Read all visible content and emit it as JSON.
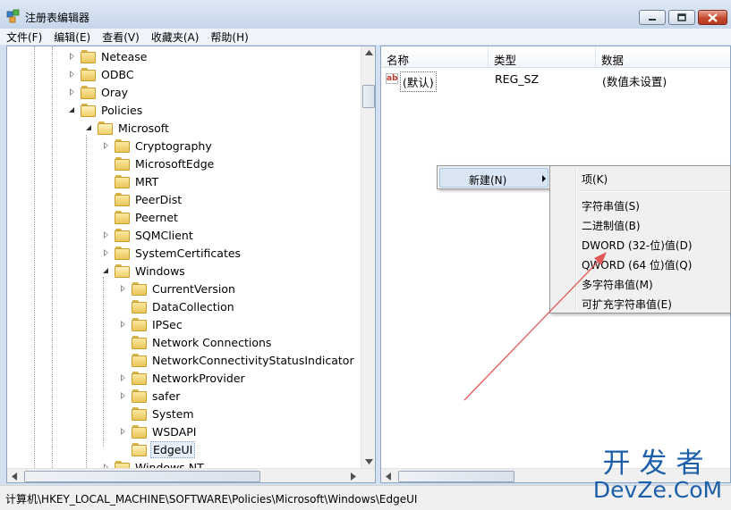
{
  "window": {
    "title": "注册表编辑器",
    "icon": "regedit-icon"
  },
  "menubar": {
    "items": [
      "文件(F)",
      "编辑(E)",
      "查看(V)",
      "收藏夹(A)",
      "帮助(H)"
    ]
  },
  "tree": {
    "nodes": [
      {
        "label": "Netease",
        "state": "collapsed",
        "depth": 3
      },
      {
        "label": "ODBC",
        "state": "collapsed",
        "depth": 3
      },
      {
        "label": "Oray",
        "state": "collapsed",
        "depth": 3
      },
      {
        "label": "Policies",
        "state": "expanded",
        "depth": 3
      },
      {
        "label": "Microsoft",
        "state": "expanded",
        "depth": 4
      },
      {
        "label": "Cryptography",
        "state": "collapsed",
        "depth": 5
      },
      {
        "label": "MicrosoftEdge",
        "state": "leaf",
        "depth": 5
      },
      {
        "label": "MRT",
        "state": "leaf",
        "depth": 5
      },
      {
        "label": "PeerDist",
        "state": "leaf",
        "depth": 5
      },
      {
        "label": "Peernet",
        "state": "leaf",
        "depth": 5
      },
      {
        "label": "SQMClient",
        "state": "collapsed",
        "depth": 5
      },
      {
        "label": "SystemCertificates",
        "state": "collapsed",
        "depth": 5
      },
      {
        "label": "Windows",
        "state": "expanded",
        "depth": 5
      },
      {
        "label": "CurrentVersion",
        "state": "collapsed",
        "depth": 6
      },
      {
        "label": "DataCollection",
        "state": "leaf",
        "depth": 6
      },
      {
        "label": "IPSec",
        "state": "collapsed",
        "depth": 6
      },
      {
        "label": "Network Connections",
        "state": "leaf",
        "depth": 6
      },
      {
        "label": "NetworkConnectivityStatusIndicator",
        "state": "leaf",
        "depth": 6
      },
      {
        "label": "NetworkProvider",
        "state": "collapsed",
        "depth": 6
      },
      {
        "label": "safer",
        "state": "collapsed",
        "depth": 6
      },
      {
        "label": "System",
        "state": "leaf",
        "depth": 6
      },
      {
        "label": "WSDAPI",
        "state": "collapsed",
        "depth": 6
      },
      {
        "label": "EdgeUI",
        "state": "selected",
        "depth": 6
      },
      {
        "label": "Windows NT",
        "state": "collapsed",
        "depth": 5
      }
    ]
  },
  "values": {
    "columns": [
      "名称",
      "类型",
      "数据"
    ],
    "rows": [
      {
        "icon": "string-value-icon",
        "icon_text": "ab",
        "name": "(默认)",
        "type": "REG_SZ",
        "data": "(数值未设置)"
      }
    ]
  },
  "context_menu": {
    "new_label": "新建(N)"
  },
  "submenu": {
    "items": [
      "项(K)",
      "字符串值(S)",
      "二进制值(B)",
      "DWORD (32-位)值(D)",
      "QWORD (64 位)值(Q)",
      "多字符串值(M)",
      "可扩充字符串值(E)"
    ]
  },
  "statusbar": {
    "path": "计算机\\HKEY_LOCAL_MACHINE\\SOFTWARE\\Policies\\Microsoft\\Windows\\EdgeUI"
  },
  "annotation": {
    "color": "#e05a5a"
  },
  "watermark": {
    "line1": "开发者",
    "line2": "DevZe.CoM",
    "color": "#1c5fa8"
  }
}
